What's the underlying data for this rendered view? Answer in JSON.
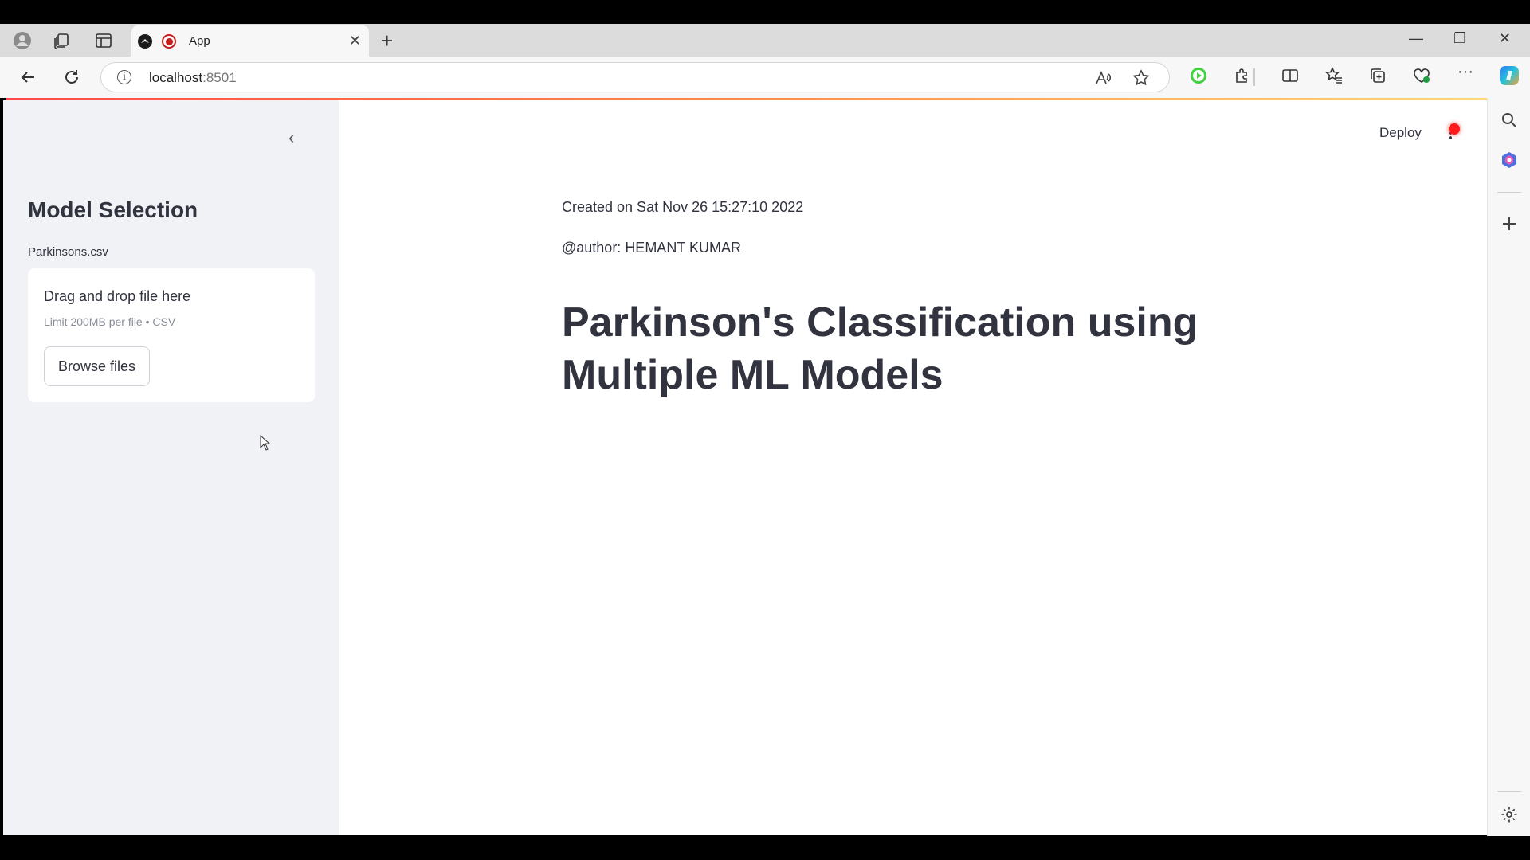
{
  "browser": {
    "tab_title": "App",
    "url_host": "localhost",
    "url_port": ":8501",
    "new_tab_symbol": "+",
    "close_tab_symbol": "✕",
    "window_controls": {
      "minimize": "—",
      "restore": "❐",
      "close": "✕"
    },
    "more_symbol": "···"
  },
  "sidebar": {
    "collapse_symbol": "‹",
    "title": "Model Selection",
    "file_label": "Parkinsons.csv",
    "uploader": {
      "title": "Drag and drop file here",
      "subtitle": "Limit 200MB per file • CSV",
      "button_label": "Browse files"
    }
  },
  "header": {
    "deploy_label": "Deploy",
    "status_color": "#ff1b1b"
  },
  "main": {
    "created_text": "Created on Sat Nov 26 15:27:10 2022",
    "author_text": "@author: HEMANT KUMAR",
    "heading": "Parkinson's Classification using Multiple ML Models"
  },
  "colors": {
    "accent": "#ff4b4b",
    "sidebar_bg": "#f0f2f6",
    "text": "#31333f"
  },
  "icons": [
    "profile-icon",
    "collections-icon",
    "tab-actions-icon",
    "streamlit-favicon",
    "recording-icon",
    "back-icon",
    "refresh-icon",
    "info-icon",
    "read-aloud-icon",
    "favorite-star-icon",
    "extension-play-icon",
    "extensions-icon",
    "split-screen-icon",
    "favorites-icon",
    "collections-toolbar-icon",
    "browser-essentials-icon",
    "more-icon",
    "copilot-icon",
    "search-icon",
    "office-icon",
    "add-icon",
    "settings-icon"
  ]
}
